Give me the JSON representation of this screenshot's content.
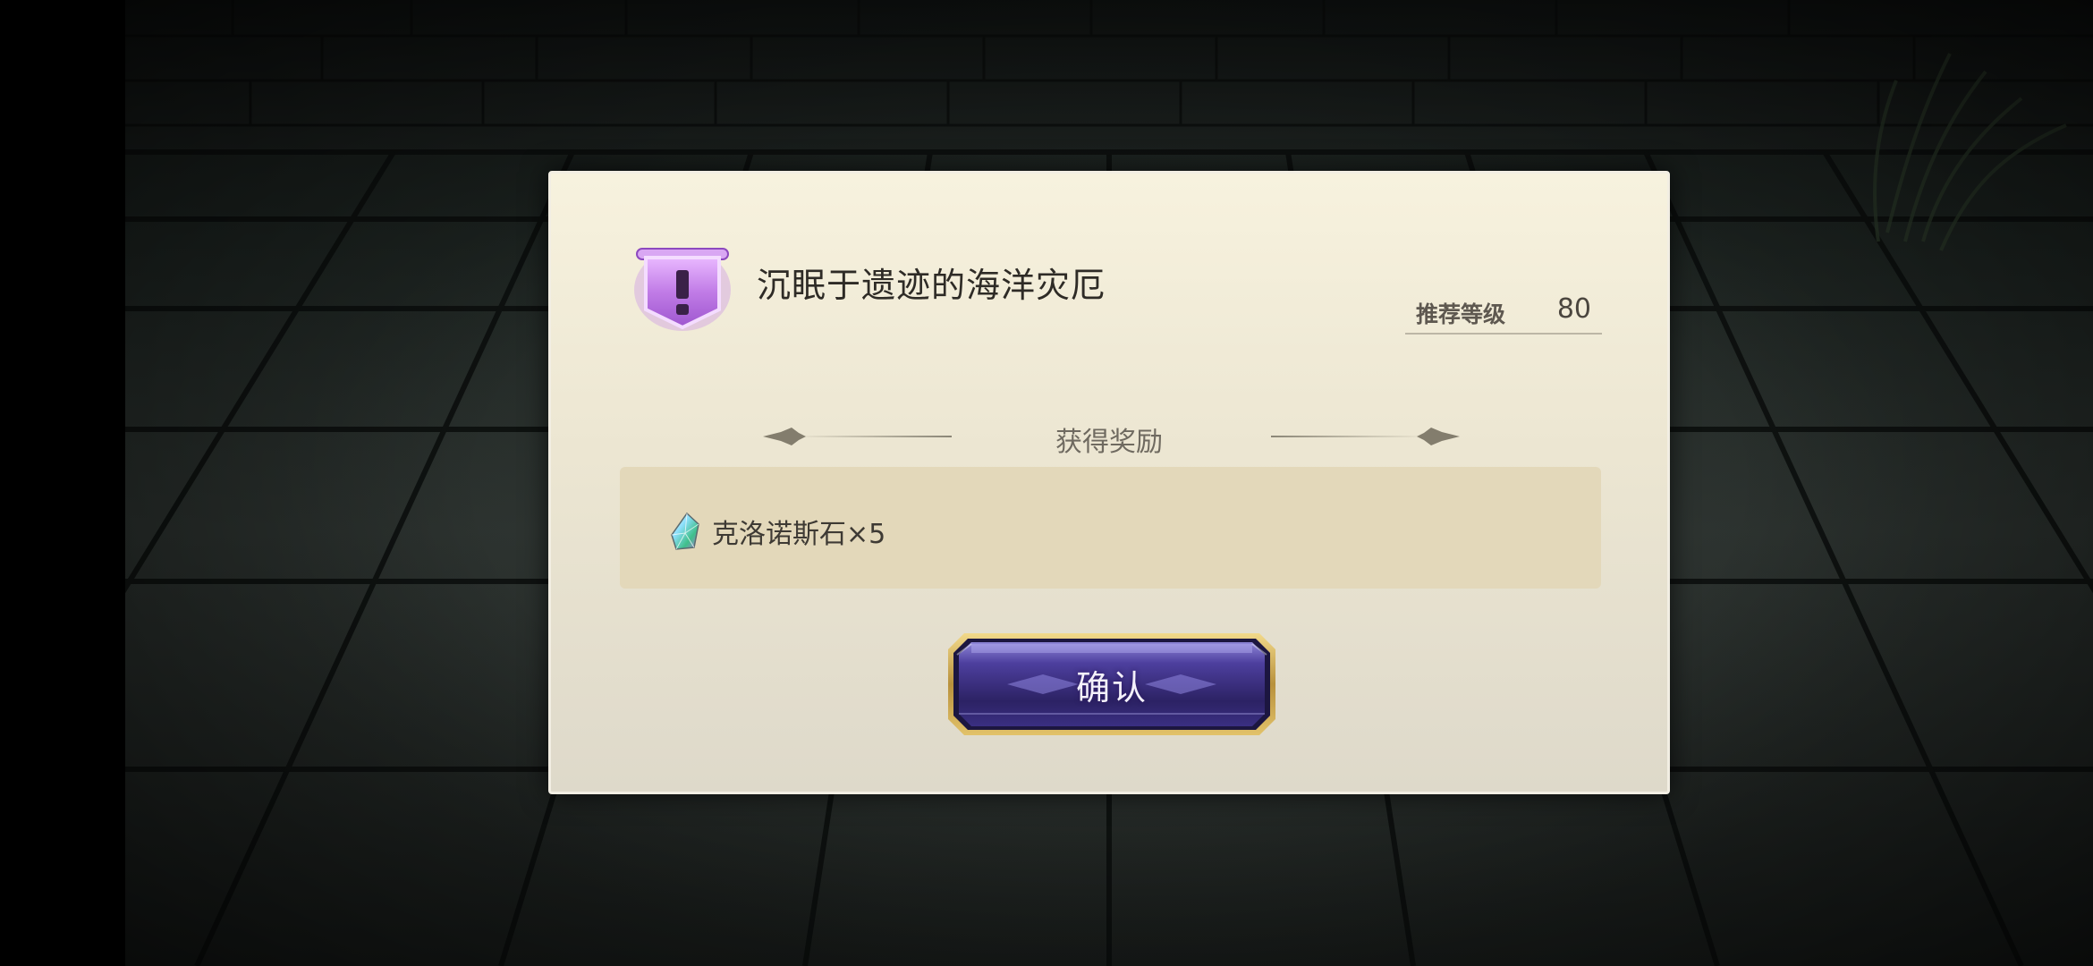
{
  "quest": {
    "title": "沉眠于遗迹的海洋灾厄",
    "badge_icon": "exclamation-shield-icon",
    "recommended_level_label": "推荐等级",
    "recommended_level_value": "80"
  },
  "rewards": {
    "header": "获得奖励",
    "items": [
      {
        "icon": "chronos-stone-gem-icon",
        "text": "克洛诺斯石×5"
      }
    ]
  },
  "actions": {
    "confirm_label": "确认"
  },
  "colors": {
    "badge_purple": "#b46fe0",
    "button_purple": "#4a3f95",
    "button_gold": "#c9a64a",
    "dialog_bg": "#f2ecd8",
    "reward_panel_bg": "#e3d8ba"
  }
}
